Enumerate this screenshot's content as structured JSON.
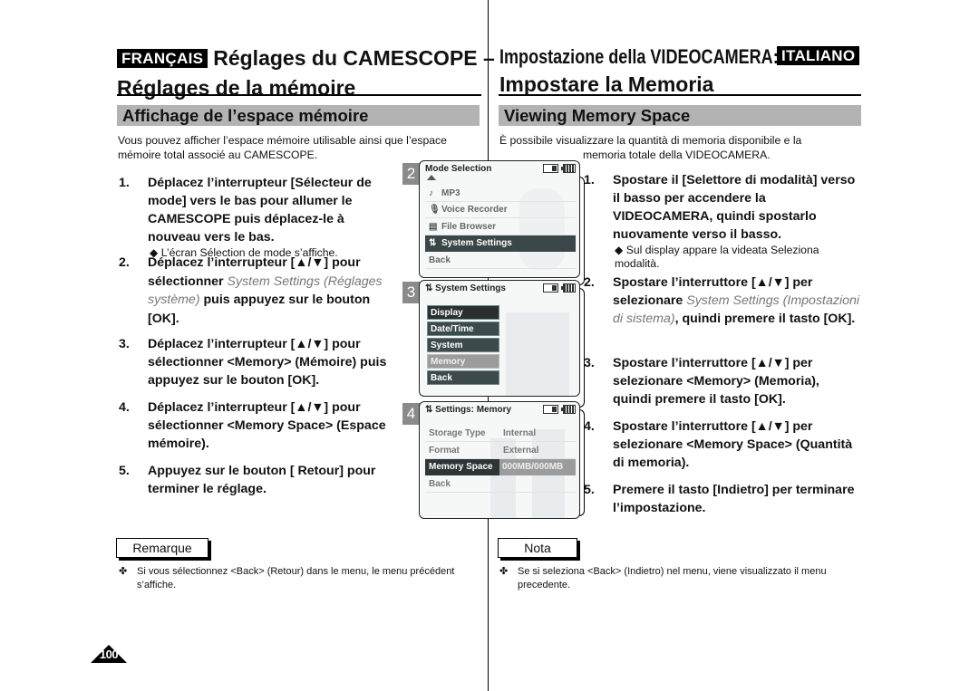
{
  "header": {
    "fr_badge": "FRANÇAIS",
    "fr_title_line1": "Réglages du CAMESCOPE –",
    "fr_title_line2": "Réglages de la mémoire",
    "it_title_line1": "Impostazione della VIDEOCAMERA:",
    "it_badge": "ITALIANO",
    "it_title_line2": "Impostare la Memoria"
  },
  "fr": {
    "section_title": "Affichage de l’espace mémoire",
    "intro": "Vous pouvez afficher l’espace mémoire utilisable ainsi que l’espace mémoire total associé au CAMESCOPE.",
    "steps": [
      {
        "num": "1.",
        "text": "Déplacez l’interrupteur [Sélecteur de mode] vers le bas pour allumer le CAMESCOPE puis déplacez-le à nouveau vers le bas.",
        "sub": "◆ L’écran Sélection de mode s’affiche."
      },
      {
        "num": "2.",
        "text_a": "Déplacez l’interrupteur [▲/▼] pour sélectionner ",
        "text_it": "System Settings (Réglages système)",
        "text_b": " puis appuyez sur le bouton [OK]."
      },
      {
        "num": "3.",
        "text": "Déplacez l’interrupteur [▲/▼] pour sélectionner <Memory> (Mémoire) puis appuyez sur le bouton [OK]."
      },
      {
        "num": "4.",
        "text": "Déplacez l’interrupteur [▲/▼] pour sélectionner <Memory Space> (Espace mémoire)."
      },
      {
        "num": "5.",
        "text": "Appuyez sur le bouton [ Retour] pour terminer le réglage."
      }
    ],
    "note_label": "Remarque",
    "note_text": "Si vous sélectionnez <Back> (Retour) dans le menu, le menu précédent s’affiche."
  },
  "it": {
    "section_title": "Viewing Memory Space",
    "intro_line1": "È possibile visualizzare la quantità di memoria disponibile e la",
    "intro_line2": "memoria totale della VIDEOCAMERA.",
    "steps": [
      {
        "num": "1.",
        "text": "Spostare il [Selettore di modalità] verso il basso per accendere la VIDEOCAMERA, quindi spostarlo nuovamente verso il basso.",
        "sub": "◆ Sul display appare la videata Seleziona modalità."
      },
      {
        "num": "2.",
        "text_a": "Spostare l’interruttore [▲/▼] per selezionare ",
        "text_it": "System Settings (Impostazioni di sistema)",
        "text_b": ", quindi premere il tasto [OK]."
      },
      {
        "num": "3.",
        "text": "Spostare l’interruttore [▲/▼] per selezionare <Memory> (Memoria), quindi premere il tasto [OK]."
      },
      {
        "num": "4.",
        "text": "Spostare l’interruttore [▲/▼] per selezionare <Memory Space> (Quantità di memoria)."
      },
      {
        "num": "5.",
        "text": "Premere il tasto [Indietro] per terminare l’impostazione."
      }
    ],
    "note_label": "Nota",
    "note_text": "Se si seleziona <Back> (Indietro) nel menu, viene visualizzato il menu precedente."
  },
  "screens": {
    "s2": {
      "num": "2",
      "title": "Mode Selection",
      "items": [
        {
          "icon": "♪",
          "label": "MP3"
        },
        {
          "icon": "🎙",
          "label": "Voice Recorder"
        },
        {
          "icon": "▤",
          "label": "File Browser"
        },
        {
          "icon": "⇅",
          "label": "System Settings",
          "selected": true
        },
        {
          "icon": "",
          "label": "Back"
        }
      ]
    },
    "s3": {
      "num": "3",
      "title": "System Settings",
      "items": [
        "Display",
        "Date/Time",
        "System",
        "Memory",
        "Back"
      ],
      "highlighted": "Memory"
    },
    "s4": {
      "num": "4",
      "title": "Settings: Memory",
      "rows": [
        {
          "key": "Storage Type",
          "value": "Internal"
        },
        {
          "key": "Format",
          "value": "External"
        },
        {
          "key": "Memory Space",
          "value": "000MB/000MB",
          "selected": true
        },
        {
          "key": "Back",
          "value": ""
        }
      ]
    }
  },
  "page_number": "100",
  "bullet_symbol": "✤"
}
